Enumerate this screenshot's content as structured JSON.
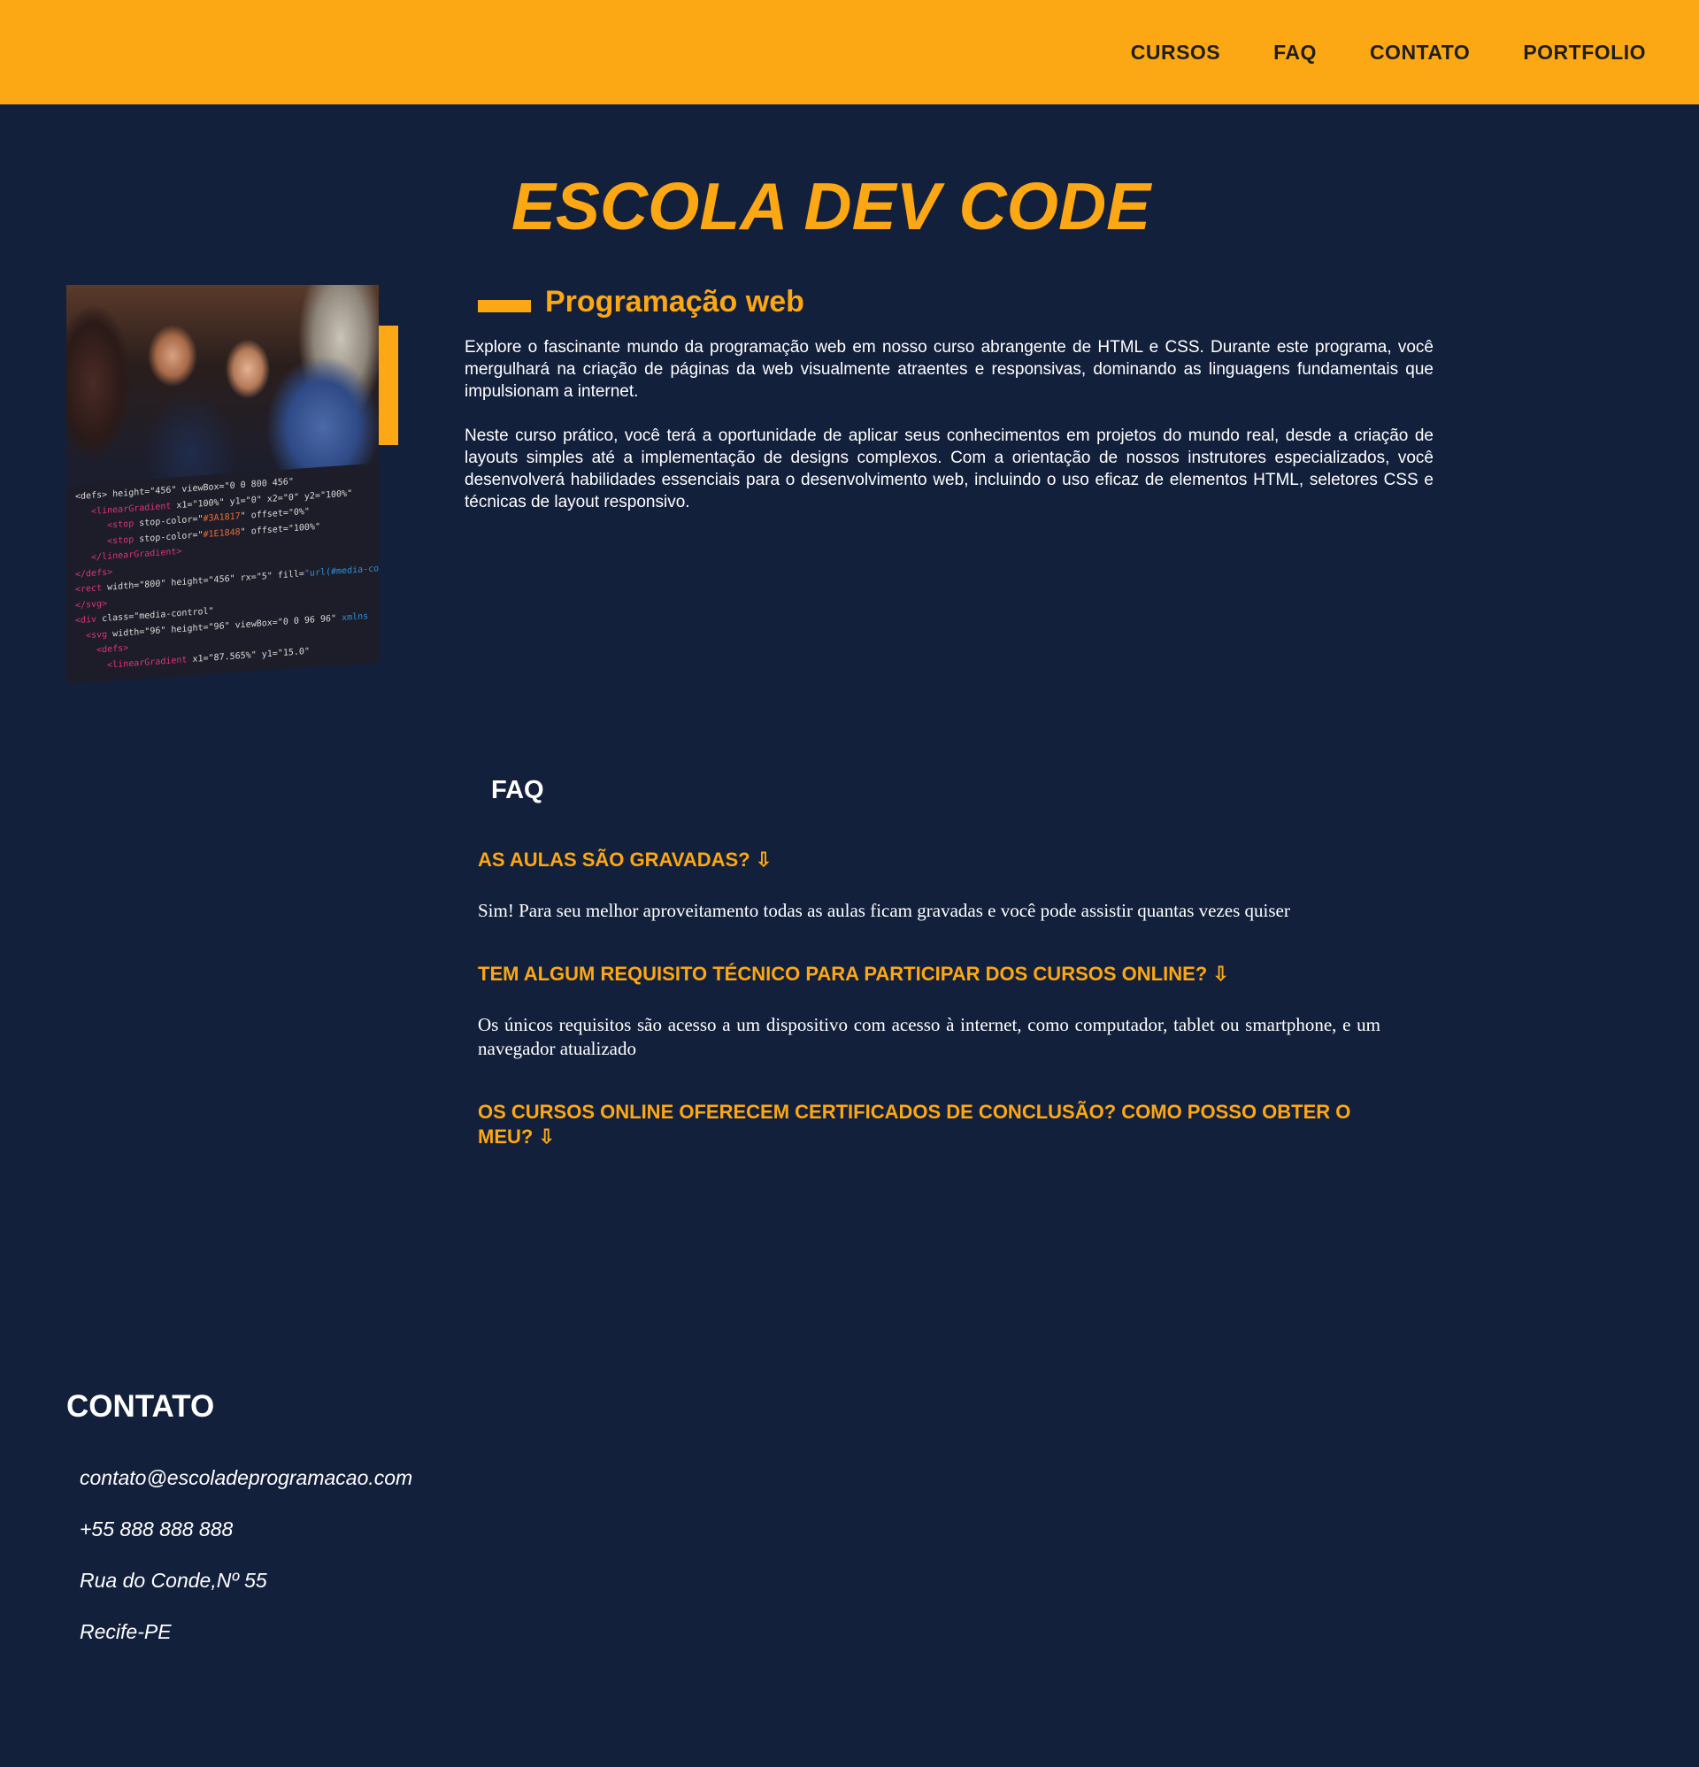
{
  "header": {
    "nav": [
      "CURSOS",
      "FAQ",
      "CONTATO",
      "PORTFOLIO"
    ]
  },
  "hero": {
    "title": "ESCOLA DEV CODE"
  },
  "course": {
    "heading": "Programação web",
    "paragraphs": [
      "Explore o fascinante mundo da programação web em nosso curso abrangente de HTML e CSS. Durante este programa, você mergulhará na criação de páginas da web visualmente atraentes e responsivas, dominando as linguagens fundamentais que impulsionam a internet.",
      "Neste curso prático, você terá a oportunidade de aplicar seus conhecimentos em projetos do mundo real, desde a criação de layouts simples até a implementação de designs complexos. Com a orientação de nossos instrutores especializados, você desenvolverá habilidades essenciais para o desenvolvimento web, incluindo o uso eficaz de elementos HTML, seletores CSS e técnicas de layout responsivo."
    ]
  },
  "faq": {
    "title": "FAQ",
    "items": [
      {
        "question": "AS AULAS SÃO GRAVADAS? ⇩",
        "answer": "Sim! Para seu melhor aproveitamento todas as aulas ficam gravadas e você pode assistir quantas vezes quiser"
      },
      {
        "question": "TEM ALGUM REQUISITO TÉCNICO PARA PARTICIPAR DOS CURSOS ONLINE? ⇩",
        "answer": "Os únicos requisitos são acesso a um dispositivo com acesso à internet, como computador, tablet ou smartphone, e um navegador atualizado"
      },
      {
        "question": "OS CURSOS ONLINE OFERECEM CERTIFICADOS DE CONCLUSÃO? COMO POSSO OBTER O MEU? ⇩",
        "answer": ""
      }
    ]
  },
  "contact": {
    "title": "CONTATO",
    "items": [
      "contato@escoladeprogramacao.com",
      "+55 888 888 888",
      "Rua do Conde,Nº 55",
      "Recife-PE"
    ]
  },
  "colors": {
    "accent": "#fca714",
    "background": "#13203c",
    "nav_text": "#1e1e1e",
    "text": "#ffffff"
  }
}
